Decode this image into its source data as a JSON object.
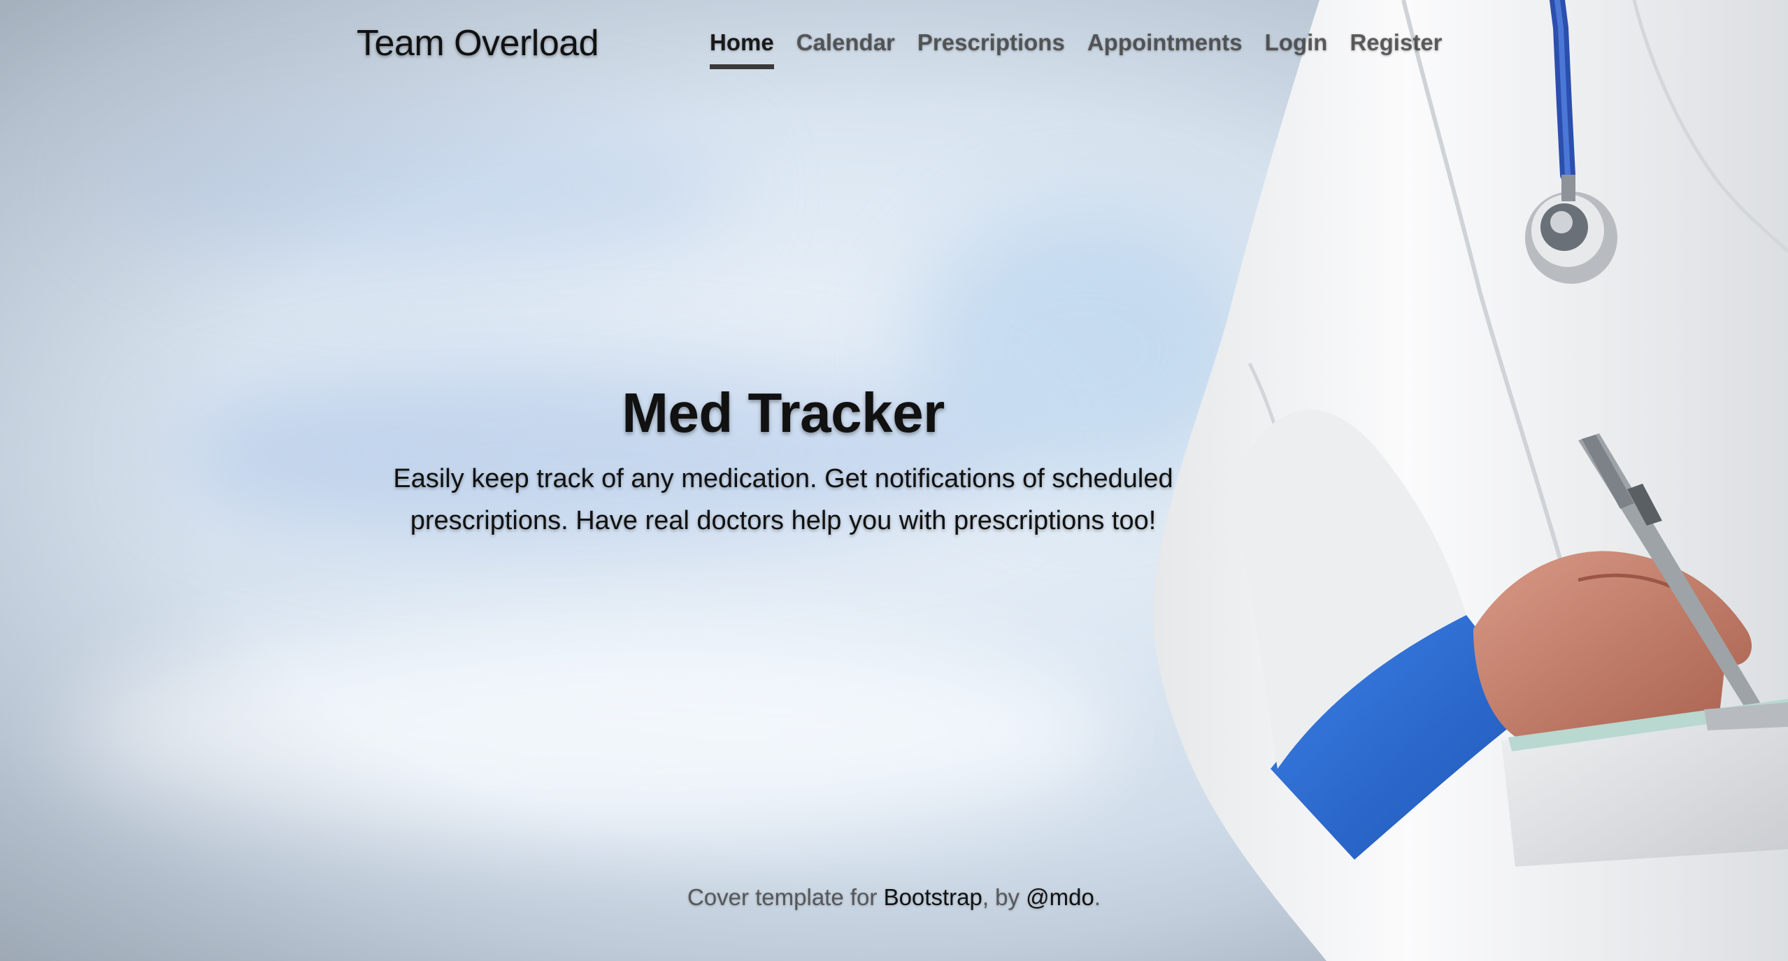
{
  "header": {
    "brand": "Team Overload",
    "nav": [
      {
        "label": "Home",
        "active": true
      },
      {
        "label": "Calendar",
        "active": false
      },
      {
        "label": "Prescriptions",
        "active": false
      },
      {
        "label": "Appointments",
        "active": false
      },
      {
        "label": "Login",
        "active": false
      },
      {
        "label": "Register",
        "active": false
      }
    ]
  },
  "hero": {
    "title": "Med Tracker",
    "lead_line1": "Easily keep track of any medication. Get notifications of scheduled",
    "lead_line2": "prescriptions. Have real doctors help you with prescriptions too!"
  },
  "footer": {
    "prefix": "Cover template for ",
    "bootstrap_link": "Bootstrap",
    "middle": ", by ",
    "author_link": "@mdo",
    "suffix": "."
  },
  "colors": {
    "coat": "#f4f5f6",
    "sleeve": "#2f6fd6",
    "skin": "#c98470",
    "stethoscope_tube": "#2c4fae"
  }
}
